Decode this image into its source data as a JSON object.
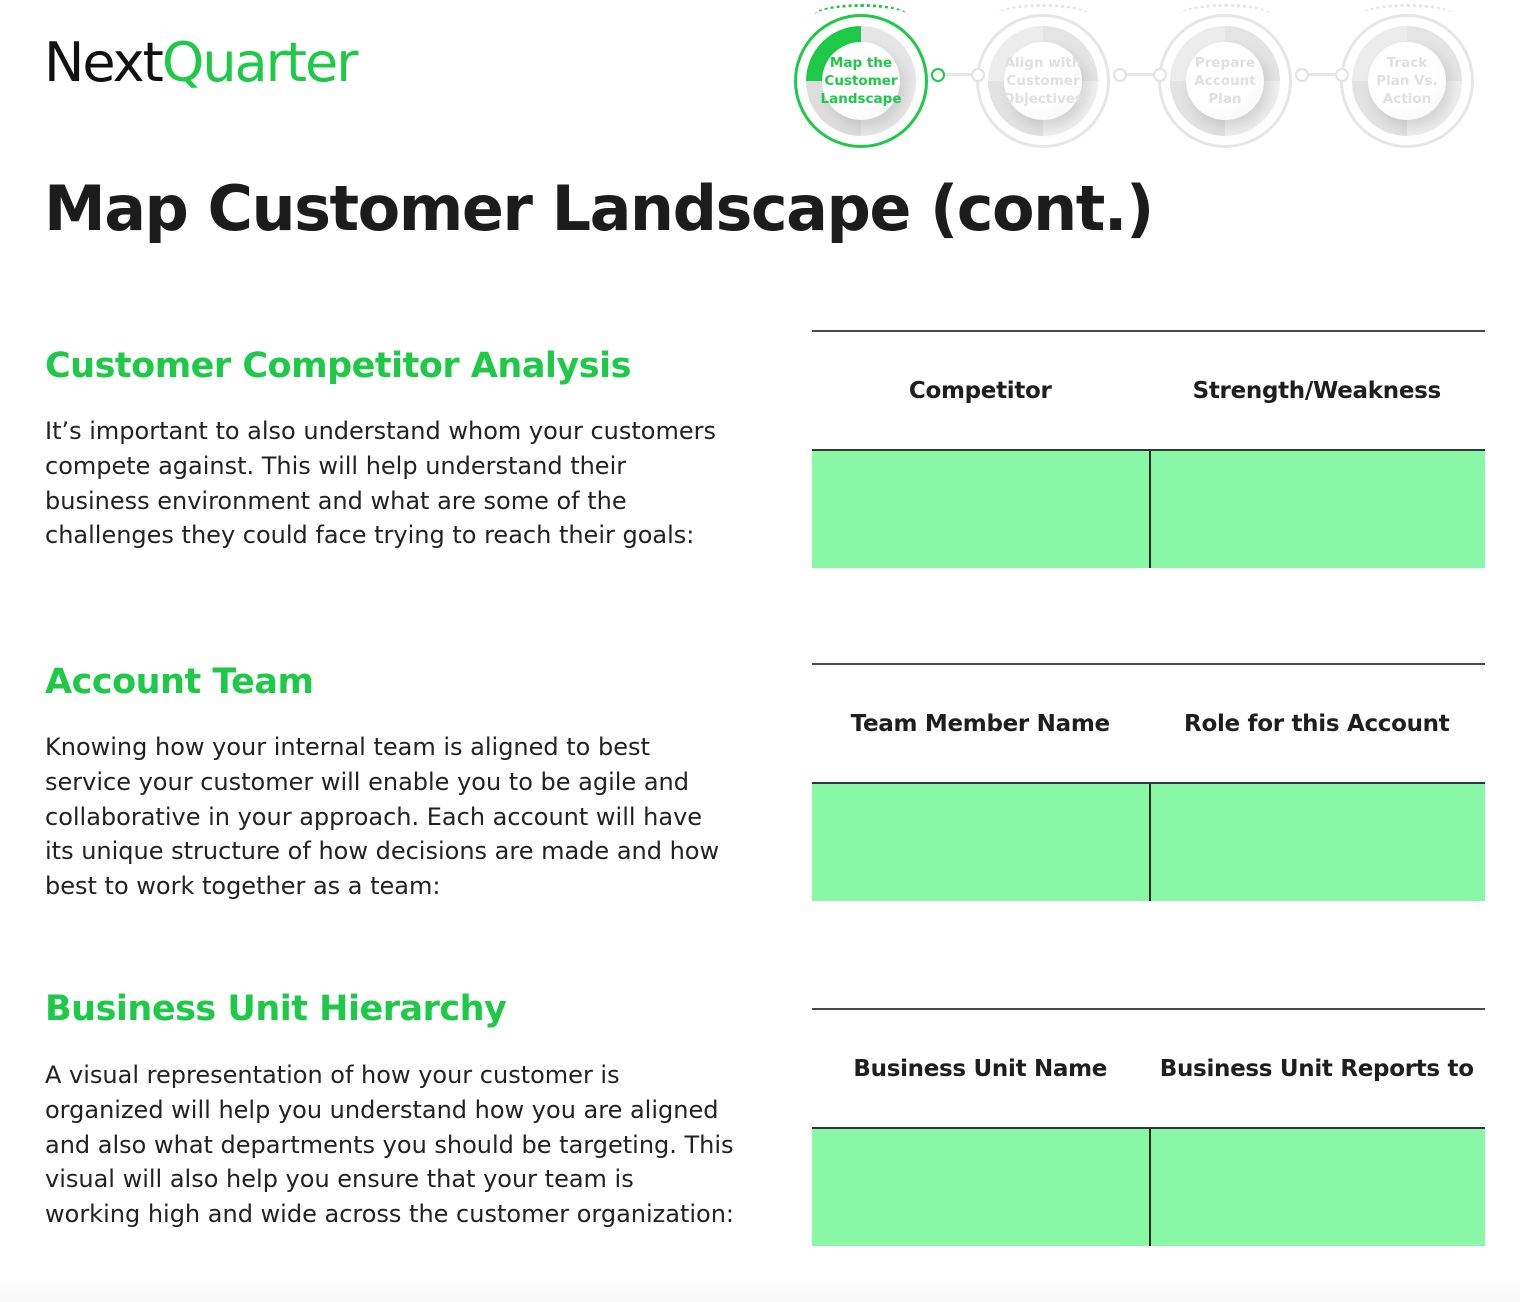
{
  "brand": {
    "logo_part1": "Next",
    "logo_part2": "Quarter",
    "accent_color": "#1ec947",
    "fill_color": "#88f8a7"
  },
  "stepper": {
    "steps": [
      {
        "label_lines": [
          "Map the",
          "Customer",
          "Landscape"
        ],
        "state": "active"
      },
      {
        "label_lines": [
          "Align with",
          "Customer",
          "Objectives"
        ],
        "state": "inactive"
      },
      {
        "label_lines": [
          "Prepare",
          "Account",
          "Plan"
        ],
        "state": "inactive"
      },
      {
        "label_lines": [
          "Track",
          "Plan Vs.",
          "Action"
        ],
        "state": "inactive"
      }
    ]
  },
  "page": {
    "title": "Map Customer Landscape (cont.)"
  },
  "sections": [
    {
      "heading": "Customer Competitor Analysis",
      "body": "It’s important to also understand whom your customers compete against. This will help understand their business environment and what are some of the challenges they could face trying to reach their goals:",
      "table": {
        "columns": [
          "Competitor",
          "Strength/Weakness"
        ],
        "rows": [
          [
            "",
            ""
          ]
        ]
      }
    },
    {
      "heading": "Account Team",
      "body": "Knowing how your internal team is aligned to best service your customer will enable you to be agile and collaborative in your approach. Each account will have its unique structure of how decisions are made and how best to work together as a team:",
      "table": {
        "columns": [
          "Team Member Name",
          "Role for this Account"
        ],
        "rows": [
          [
            "",
            ""
          ]
        ]
      }
    },
    {
      "heading": "Business Unit Hierarchy",
      "body": "A visual representation of how your customer is organized will help you understand how you are aligned and also what departments you should be targeting. This visual will also help you ensure that your team is working high and wide across the customer organization:",
      "table": {
        "columns": [
          "Business Unit Name",
          "Business Unit Reports to"
        ],
        "rows": [
          [
            "",
            ""
          ]
        ]
      }
    }
  ]
}
